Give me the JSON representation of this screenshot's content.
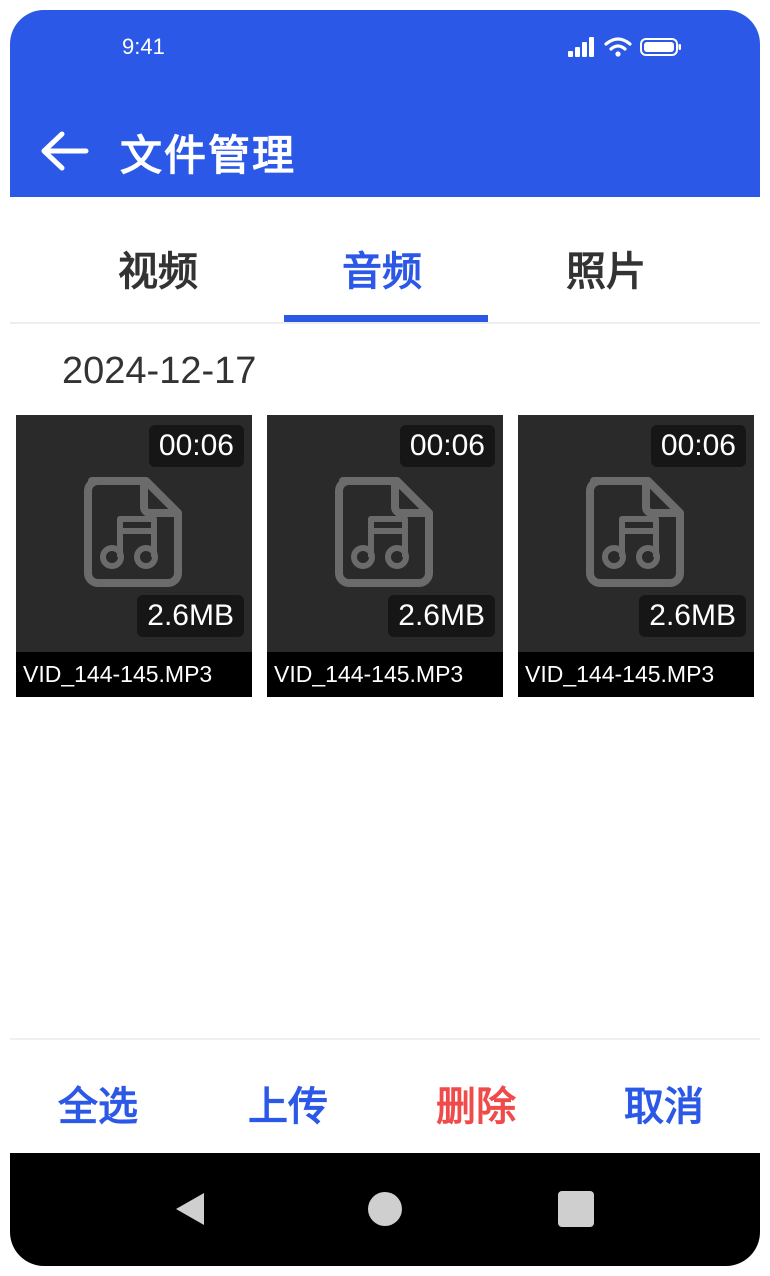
{
  "status": {
    "time": "9:41",
    "icons": [
      "signal-icon",
      "wifi-icon",
      "battery-icon"
    ]
  },
  "header": {
    "title": "文件管理",
    "back_icon": "back-arrow-icon"
  },
  "tabs": [
    {
      "label": "视频",
      "active": false
    },
    {
      "label": "音频",
      "active": true
    },
    {
      "label": "照片",
      "active": false
    }
  ],
  "section": {
    "date": "2024-12-17"
  },
  "files": [
    {
      "duration": "00:06",
      "size": "2.6MB",
      "name": "VID_144-145.MP3",
      "icon": "audio-file-icon"
    },
    {
      "duration": "00:06",
      "size": "2.6MB",
      "name": "VID_144-145.MP3",
      "icon": "audio-file-icon"
    },
    {
      "duration": "00:06",
      "size": "2.6MB",
      "name": "VID_144-145.MP3",
      "icon": "audio-file-icon"
    }
  ],
  "actions": {
    "select_all": "全选",
    "upload": "上传",
    "delete": "删除",
    "cancel": "取消"
  },
  "nav": {
    "icons": [
      "nav-back-icon",
      "nav-home-icon",
      "nav-recents-icon"
    ]
  },
  "colors": {
    "primary": "#2B58E6",
    "danger": "#F04B4B",
    "card_bg": "#2a2a2a"
  }
}
